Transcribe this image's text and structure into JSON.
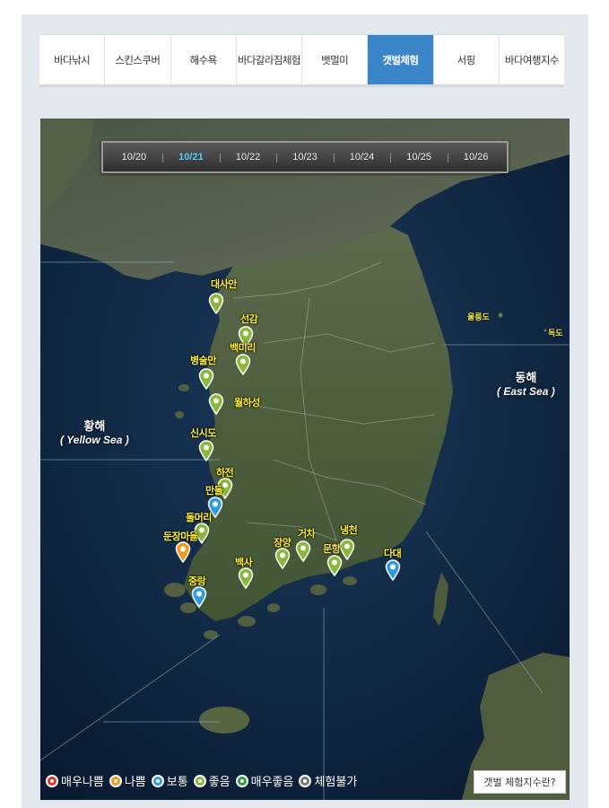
{
  "tabs": [
    {
      "label": "바다낚시",
      "active": false
    },
    {
      "label": "스킨스쿠버",
      "active": false
    },
    {
      "label": "해수욕",
      "active": false
    },
    {
      "label": "바다갈라짐체험",
      "active": false
    },
    {
      "label": "뱃멀미",
      "active": false
    },
    {
      "label": "갯벌체험",
      "active": true
    },
    {
      "label": "서핑",
      "active": false
    },
    {
      "label": "바다여행지수",
      "active": false
    }
  ],
  "dates": [
    "10/20",
    "10/21",
    "10/22",
    "10/23",
    "10/24",
    "10/25",
    "10/26"
  ],
  "active_date": "10/21",
  "seas": {
    "yellow": {
      "ko": "황해",
      "en": "( Yellow Sea )"
    },
    "east": {
      "ko": "동해",
      "en": "( East Sea )"
    }
  },
  "islands": {
    "ulleungdo": "울릉도",
    "dokdo": "독도"
  },
  "locations": [
    {
      "name": "대사안",
      "status": "good"
    },
    {
      "name": "선감",
      "status": "good"
    },
    {
      "name": "백미리",
      "status": "good"
    },
    {
      "name": "병술만",
      "status": "good"
    },
    {
      "name": "월하성",
      "status": "good"
    },
    {
      "name": "신시도",
      "status": "good"
    },
    {
      "name": "하전",
      "status": "good"
    },
    {
      "name": "만돌",
      "status": "normal"
    },
    {
      "name": "돌머리",
      "status": "good"
    },
    {
      "name": "둔장마을",
      "status": "bad"
    },
    {
      "name": "장양",
      "status": "good"
    },
    {
      "name": "거차",
      "status": "good"
    },
    {
      "name": "냉천",
      "status": "good"
    },
    {
      "name": "문항",
      "status": "good"
    },
    {
      "name": "백사",
      "status": "good"
    },
    {
      "name": "다대",
      "status": "normal"
    },
    {
      "name": "중랑",
      "status": "normal"
    }
  ],
  "legend": [
    {
      "label": "매우나쁨",
      "color": "#e0302a"
    },
    {
      "label": "나쁨",
      "color": "#f39a1e"
    },
    {
      "label": "보통",
      "color": "#2f9be0"
    },
    {
      "label": "좋음",
      "color": "#8ab83a"
    },
    {
      "label": "매우좋음",
      "color": "#2e9a3e"
    },
    {
      "label": "체험불가",
      "color": "#777777"
    }
  ],
  "status_colors": {
    "very_bad": "#e0302a",
    "bad": "#f39a1e",
    "normal": "#2f9be0",
    "good": "#8ab83a",
    "very_good": "#2e9a3e",
    "unavailable": "#777777"
  },
  "help_button": "갯벌 체험지수란?"
}
